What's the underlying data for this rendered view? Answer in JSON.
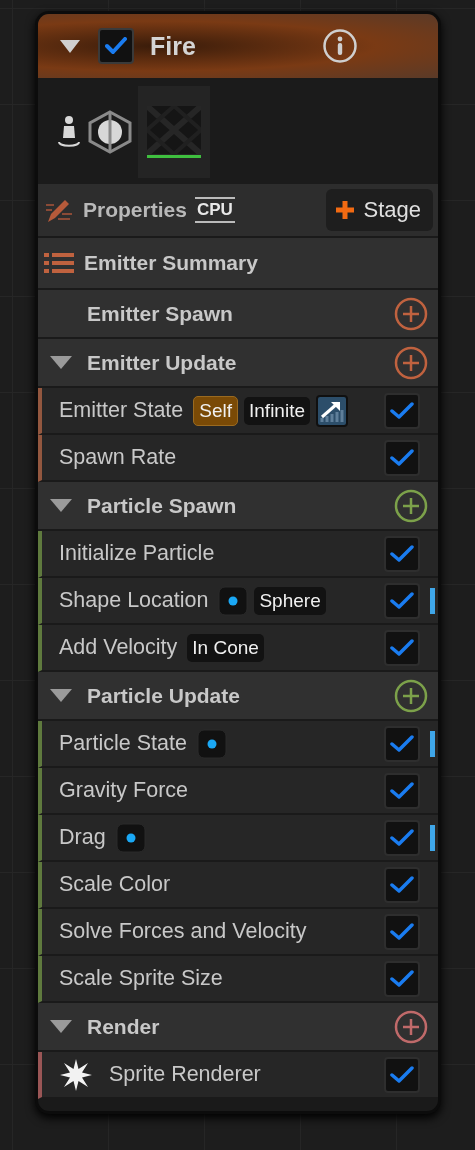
{
  "node": {
    "title": "Fire",
    "expanded": true,
    "enabled": true
  },
  "toolbar": {
    "properties_label": "Properties",
    "sim_target": "CPU",
    "stage_button": "Stage"
  },
  "summary": {
    "label": "Emitter Summary"
  },
  "sections": [
    {
      "title": "Emitter Spawn",
      "expandable": false,
      "color": "#c0623f"
    },
    {
      "title": "Emitter Update",
      "expandable": true,
      "color": "#c0623f",
      "items": [
        {
          "label": "Emitter State",
          "kind": "module",
          "checked": true,
          "indicator": false,
          "chips": [
            {
              "kind": "tag",
              "text": "Self"
            },
            {
              "kind": "value",
              "text": "Infinite"
            },
            {
              "kind": "curve"
            }
          ]
        },
        {
          "label": "Spawn Rate",
          "kind": "module",
          "checked": true,
          "indicator": false
        }
      ]
    },
    {
      "title": "Particle Spawn",
      "expandable": true,
      "color": "#7ca14a",
      "items": [
        {
          "label": "Initialize Particle",
          "kind": "module",
          "checked": true,
          "indicator": false
        },
        {
          "label": "Shape Location",
          "kind": "module",
          "checked": true,
          "indicator": true,
          "chips": [
            {
              "kind": "dot"
            },
            {
              "kind": "value",
              "text": "Sphere"
            }
          ]
        },
        {
          "label": "Add Velocity",
          "kind": "module",
          "checked": true,
          "indicator": false,
          "chips": [
            {
              "kind": "value",
              "text": "In Cone"
            }
          ]
        }
      ]
    },
    {
      "title": "Particle Update",
      "expandable": true,
      "color": "#7ca14a",
      "items": [
        {
          "label": "Particle State",
          "kind": "module",
          "checked": true,
          "indicator": true,
          "chips": [
            {
              "kind": "dot"
            }
          ]
        },
        {
          "label": "Gravity Force",
          "kind": "module",
          "checked": true,
          "indicator": false
        },
        {
          "label": "Drag",
          "kind": "module",
          "checked": true,
          "indicator": true,
          "chips": [
            {
              "kind": "dot"
            }
          ]
        },
        {
          "label": "Scale Color",
          "kind": "module",
          "checked": true,
          "indicator": false
        },
        {
          "label": "Solve Forces and Velocity",
          "kind": "module",
          "checked": true,
          "indicator": false
        },
        {
          "label": "Scale Sprite Size",
          "kind": "module",
          "checked": true,
          "indicator": false
        }
      ]
    },
    {
      "title": "Render",
      "expandable": true,
      "color": "#c06a6a",
      "items": [
        {
          "label": "Sprite Renderer",
          "kind": "renderer",
          "checked": true,
          "indicator": false
        }
      ]
    }
  ]
}
